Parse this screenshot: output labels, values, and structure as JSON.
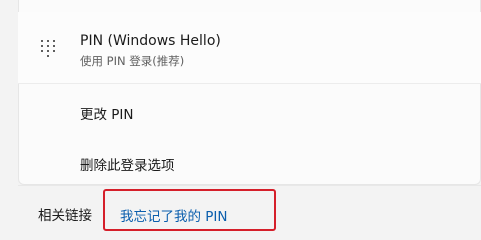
{
  "pin_setting": {
    "title": "PIN (Windows Hello)",
    "subtitle": "使用 PIN 登录(推荐)",
    "icon": "keypad-icon"
  },
  "options": {
    "change_pin": "更改 PIN",
    "remove_sign_in": "删除此登录选项"
  },
  "related_links": {
    "label": "相关链接",
    "forgot_pin": "我忘记了我的 PIN"
  },
  "colors": {
    "link": "#0a5ead",
    "highlight": "#d51f2a"
  }
}
